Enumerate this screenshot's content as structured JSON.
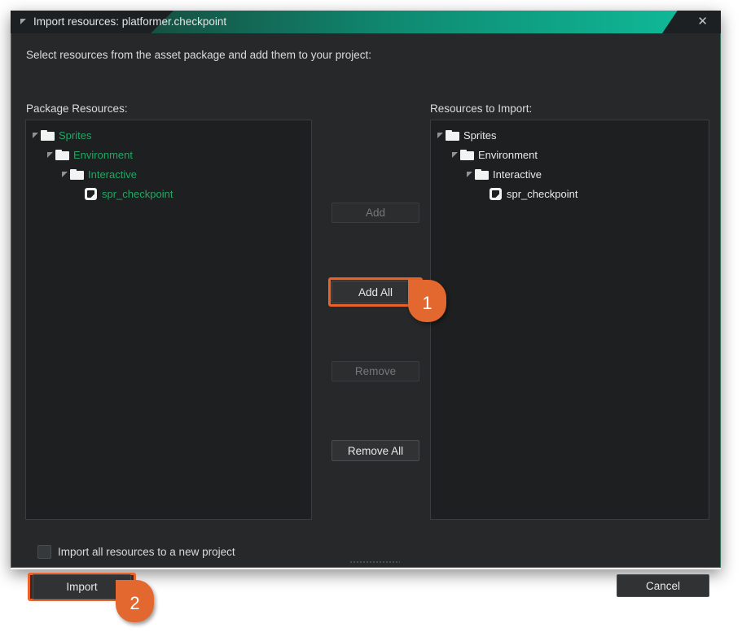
{
  "window": {
    "title": "Import resources: platformer.checkpoint",
    "titlebar_arrow_icon": "collapse-triangle-icon",
    "close_label": "✕",
    "close_icon": "close-icon",
    "accent_teal": "#0fb695",
    "body_bg": "#262829",
    "border_green": "#2f6d52"
  },
  "instructions": "Select resources from the asset package and add them to your project:",
  "left_panel": {
    "label": "Package Resources:",
    "text_color": "#1fa863",
    "items": [
      {
        "label": "Sprites",
        "icon": "folder-icon",
        "depth": 0,
        "expanded": true
      },
      {
        "label": "Environment",
        "icon": "folder-icon",
        "depth": 1,
        "expanded": true
      },
      {
        "label": "Interactive",
        "icon": "folder-icon",
        "depth": 2,
        "expanded": true
      },
      {
        "label": "spr_checkpoint",
        "icon": "sprite-icon",
        "depth": 3,
        "expanded": false
      }
    ]
  },
  "right_panel": {
    "label": "Resources to Import:",
    "text_color": "#e8eaea",
    "items": [
      {
        "label": "Sprites",
        "icon": "folder-icon",
        "depth": 0,
        "expanded": true
      },
      {
        "label": "Environment",
        "icon": "folder-icon",
        "depth": 1,
        "expanded": true
      },
      {
        "label": "Interactive",
        "icon": "folder-icon",
        "depth": 2,
        "expanded": true
      },
      {
        "label": "spr_checkpoint",
        "icon": "sprite-icon",
        "depth": 3,
        "expanded": false
      }
    ]
  },
  "center_buttons": {
    "add": "Add",
    "add_all": "Add All",
    "remove": "Remove",
    "remove_all": "Remove All"
  },
  "options": {
    "new_project_checkbox_label": "Import all resources to a new project",
    "new_project_checked": false
  },
  "footer": {
    "import": "Import",
    "cancel": "Cancel"
  },
  "callouts": {
    "highlight_color": "#e2682f",
    "badge1": "1",
    "badge2": "2"
  }
}
